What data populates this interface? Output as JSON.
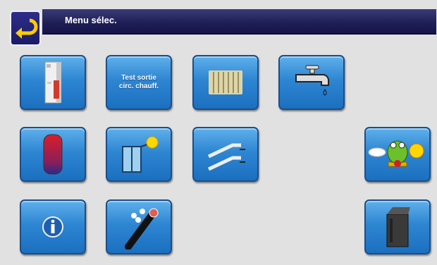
{
  "header": {
    "title": "Menu sélec."
  },
  "back_button": {
    "icon": "back-arrow-icon"
  },
  "buttons": [
    {
      "icon": "boiler-icon"
    },
    {
      "label": "Test sortie\ncirc. chauff."
    },
    {
      "icon": "radiator-icon"
    },
    {
      "icon": "water-tap-icon"
    },
    {
      "icon": "buffer-tank-icon"
    },
    {
      "icon": "solar-icon"
    },
    {
      "icon": "conveyor-icon"
    },
    {
      "icon": "frog-weather-icon"
    },
    {
      "icon": "info-icon"
    },
    {
      "icon": "pipe-sensor-icon"
    },
    {
      "icon": "pellet-boiler-icon"
    }
  ],
  "colors": {
    "header_bg": "#1e1e55",
    "button_bg": "#2e86d2",
    "background": "#e1e1e1"
  }
}
